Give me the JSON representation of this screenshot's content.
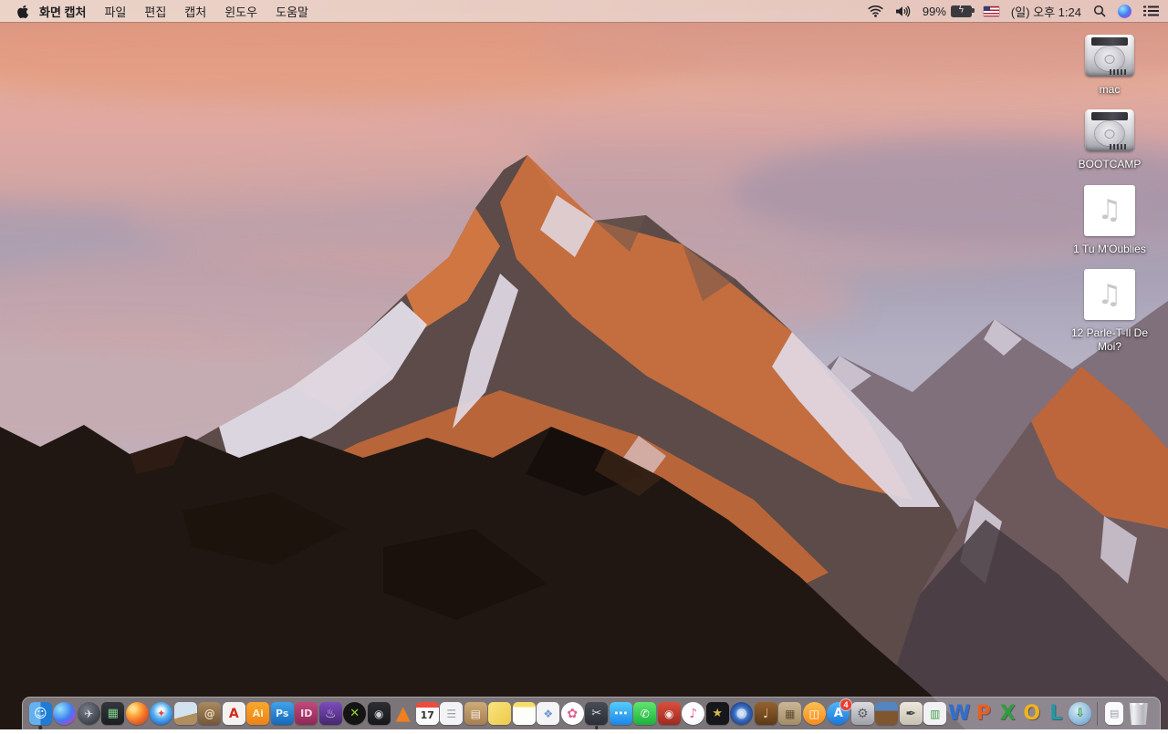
{
  "menu_bar": {
    "app_name": "화면 캡처",
    "menus": [
      "파일",
      "편집",
      "캡처",
      "윈도우",
      "도움말"
    ],
    "status": {
      "battery_percent": "99%",
      "battery_charging": true,
      "input_source": "us-flag",
      "clock": "(일) 오후 1:24"
    }
  },
  "desktop": {
    "icons": [
      {
        "name": "mac-volume",
        "label": "mac",
        "type": "drive"
      },
      {
        "name": "bootcamp-volume",
        "label": "BOOTCAMP",
        "type": "drive"
      },
      {
        "name": "music-file-1",
        "label": "1 Tu M'Oublies",
        "type": "music"
      },
      {
        "name": "music-file-2",
        "label": "12 Parle-T-Il De Moi?",
        "type": "music"
      }
    ]
  },
  "dock": {
    "items": [
      {
        "name": "finder",
        "glyph": "☺",
        "running": true
      },
      {
        "name": "siri"
      },
      {
        "name": "launchpad",
        "glyph": "✈"
      },
      {
        "name": "mission-control",
        "glyph": "▦"
      },
      {
        "name": "firefox"
      },
      {
        "name": "safari",
        "glyph": "✦"
      },
      {
        "name": "preview"
      },
      {
        "name": "contacts",
        "glyph": "@"
      },
      {
        "name": "acrobat",
        "text": "A"
      },
      {
        "name": "illustrator",
        "text": "Ai"
      },
      {
        "name": "photoshop",
        "text": "Ps"
      },
      {
        "name": "indesign",
        "text": "ID"
      },
      {
        "name": "toast",
        "glyph": "♨"
      },
      {
        "name": "divx",
        "glyph": "✕"
      },
      {
        "name": "disk-app",
        "glyph": "◉"
      },
      {
        "name": "vlc",
        "glyph": "▲"
      },
      {
        "name": "calendar",
        "text": "17"
      },
      {
        "name": "reminders",
        "glyph": "☰"
      },
      {
        "name": "unarchiver",
        "glyph": "▤"
      },
      {
        "name": "stickies"
      },
      {
        "name": "notes"
      },
      {
        "name": "documents-app",
        "glyph": "❖"
      },
      {
        "name": "photos",
        "glyph": "✿"
      },
      {
        "name": "grab",
        "glyph": "✂",
        "running": true
      },
      {
        "name": "messages",
        "glyph": "⋯"
      },
      {
        "name": "facetime",
        "glyph": "✆"
      },
      {
        "name": "photo-booth",
        "glyph": "◉"
      },
      {
        "name": "itunes",
        "glyph": "♪"
      },
      {
        "name": "imovie",
        "glyph": "★"
      },
      {
        "name": "dvd-player",
        "glyph": "◎"
      },
      {
        "name": "garageband",
        "glyph": "♩"
      },
      {
        "name": "pinboard",
        "glyph": "▦"
      },
      {
        "name": "ibooks",
        "glyph": "◫"
      },
      {
        "name": "app-store",
        "text": "A",
        "badge": "4"
      },
      {
        "name": "system-preferences",
        "glyph": "⚙"
      },
      {
        "name": "keynote"
      },
      {
        "name": "pages",
        "glyph": "✒"
      },
      {
        "name": "numbers",
        "glyph": "▥"
      },
      {
        "name": "word",
        "text": "W"
      },
      {
        "name": "powerpoint",
        "text": "P"
      },
      {
        "name": "excel",
        "text": "X"
      },
      {
        "name": "outlook",
        "text": "O"
      },
      {
        "name": "lync",
        "text": "L"
      },
      {
        "name": "downloader",
        "glyph": "⇩"
      },
      {
        "divider": true
      },
      {
        "name": "dock-document",
        "glyph": "▤"
      },
      {
        "name": "trash"
      }
    ]
  },
  "colors": {
    "menubar_tint": "#e9d2c8",
    "dock_tint": "rgba(198,195,205,0.55)",
    "badge_red": "#ef3b2f",
    "desktop_label": "#ffffff",
    "sky_salmon": "#e7ae9b",
    "sky_lavender": "#a8a1b5",
    "rock_sunlit": "#c96f3e",
    "rock_shadow": "#5c4b48",
    "foreground_rock": "#211712"
  }
}
